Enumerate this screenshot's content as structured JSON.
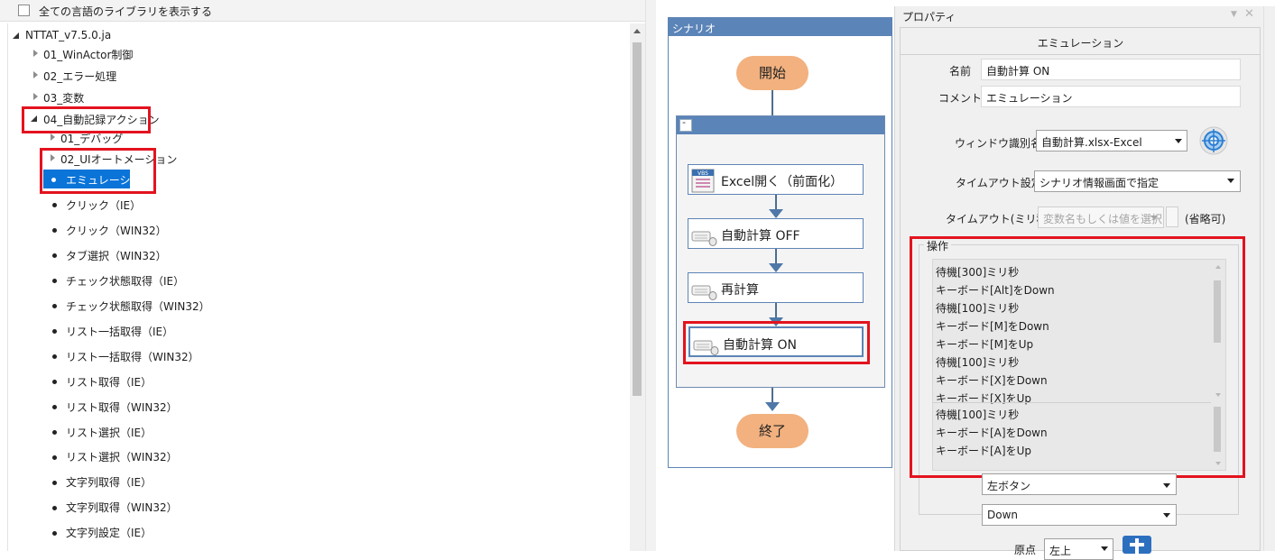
{
  "library": {
    "show_all_label": "全ての言語のライブラリを表示する",
    "show_all_checked": false,
    "root": "NTTAT_v7.5.0.ja",
    "nodes": [
      "01_WinActor制御",
      "02_エラー処理",
      "03_変数",
      "04_自動記録アクション"
    ],
    "subnodes": [
      "01_デバッグ",
      "02_UIオートメーション"
    ],
    "selected_item": "エミュレーション",
    "items": [
      "クリック（IE）",
      "クリック（WIN32）",
      "タブ選択（WIN32）",
      "チェック状態取得（IE）",
      "チェック状態取得（WIN32）",
      "リスト一括取得（IE）",
      "リスト一括取得（WIN32）",
      "リスト取得（IE）",
      "リスト取得（WIN32）",
      "リスト選択（IE）",
      "リスト選択（WIN32）",
      "文字列取得（IE）",
      "文字列取得（WIN32）",
      "文字列設定（IE）"
    ]
  },
  "scenario": {
    "title": "シナリオ",
    "start": "開始",
    "end": "終了",
    "group_button": "-",
    "actions": [
      "Excel開く（前面化）",
      "自動計算 OFF",
      "再計算",
      "自動計算 ON"
    ],
    "vbs_badge": "VBS"
  },
  "properties": {
    "panel_title": "プロパティ",
    "section_title": "エミュレーション",
    "name_label": "名前",
    "name_value": "自動計算 ON",
    "comment_label": "コメント",
    "comment_value": "エミュレーション",
    "window_label": "ウィンドウ識別名",
    "window_value": "自動計算.xlsx-Excel",
    "timeout_setting_label": "タイムアウト設定",
    "timeout_setting_value": "シナリオ情報画面で指定",
    "timeout_ms_label": "タイムアウト(ミリ秒)",
    "timeout_ms_placeholder": "変数名もしくは値を選択",
    "timeout_optional": "(省略可)",
    "operations_label": "操作",
    "operations_top": [
      "待機[300]ミリ秒",
      "キーボード[Alt]をDown",
      "待機[100]ミリ秒",
      "キーボード[M]をDown",
      "キーボード[M]をUp",
      "待機[100]ミリ秒",
      "キーボード[X]をDown",
      "キーボード[X]をUp"
    ],
    "operations_bottom": [
      "待機[100]ミリ秒",
      "キーボード[A]をDown",
      "キーボード[A]をUp"
    ],
    "mouse_button_value": "左ボタン",
    "mouse_action_value": "Down",
    "origin_label": "原点",
    "origin_value": "左上"
  },
  "colors": {
    "highlight": "#e3131e",
    "selection": "#0a74d9",
    "scenario_header": "#5b84b8",
    "terminal": "#f2b17f"
  }
}
